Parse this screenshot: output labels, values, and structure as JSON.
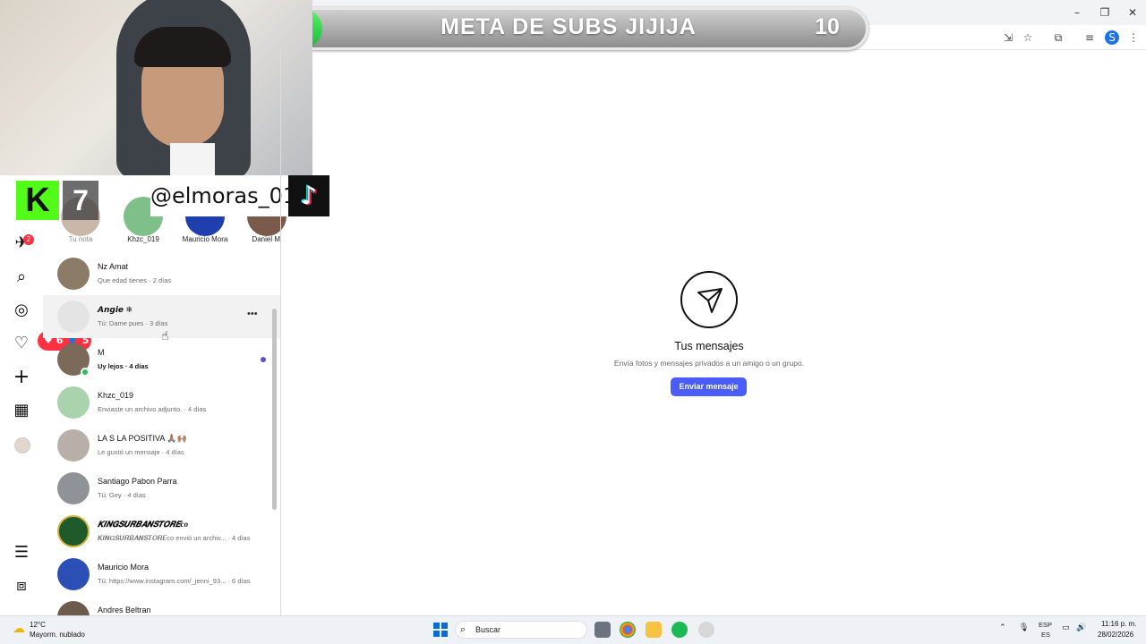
{
  "goal": {
    "current": "1",
    "title": "META DE SUBS JIJIJA",
    "target": "10"
  },
  "stream": {
    "kick_letter": "K",
    "kick_count": "7",
    "handle": "@elmoras_01",
    "likes": "6",
    "followers": "5"
  },
  "nav": {
    "notification_count": "2"
  },
  "notes": [
    {
      "label": "Tu nota"
    },
    {
      "label": "Khzc_019"
    },
    {
      "label": "Mauricio Mora"
    },
    {
      "label": "Daniel M"
    }
  ],
  "conversations": [
    {
      "name": "Nz Amat",
      "preview": "Que edad tienes · 2 días"
    },
    {
      "name": "𝘼𝙣𝙜𝙞𝙚 ❄",
      "preview": "Tú: Dame pues · 3 días"
    },
    {
      "name": "M",
      "preview": "Uy lejos · 4 días"
    },
    {
      "name": "Khzc_019",
      "preview": "Enviaste un archivo adjunto. · 4 días"
    },
    {
      "name": "LA S LA POSITIVA 🙏🏽🙌🏽",
      "preview": "Le gustó un mensaje · 4 días"
    },
    {
      "name": "Santiago Pabon Parra",
      "preview": "Tú: Gey · 4 días"
    },
    {
      "name": "𝑲𝑰𝑵𝑮𝑺𝑼𝑹𝑩𝑨𝑵𝑺𝑻𝑶𝑹𝑬co",
      "preview": "𝑲𝑰𝑵𝑮𝑺𝑼𝑹𝑩𝑨𝑵𝑺𝑻𝑶𝑹𝑬co envió un archiv... · 4 días"
    },
    {
      "name": "Mauricio Mora",
      "preview": "Tú: https://www.instagram.com/_jenni_93... · 6 días"
    },
    {
      "name": "Andres Beltran",
      "preview": ""
    }
  ],
  "empty_state": {
    "title": "Tus mensajes",
    "subtitle": "Envía fotos y mensajes privados a un amigo o un grupo.",
    "button": "Enviar mensaje"
  },
  "taskbar": {
    "weather_temp": "12°C",
    "weather_desc": "Mayorm. nublado",
    "search_label": "Buscar",
    "lang_top": "ESP",
    "lang_bottom": "ES",
    "time": "11:16 p. m.",
    "date": "28/02/2026"
  },
  "colors": {
    "accent": "#4a5df9",
    "online": "#21c35c",
    "notification": "#ff3040",
    "goal_fill": "#18b83a"
  }
}
